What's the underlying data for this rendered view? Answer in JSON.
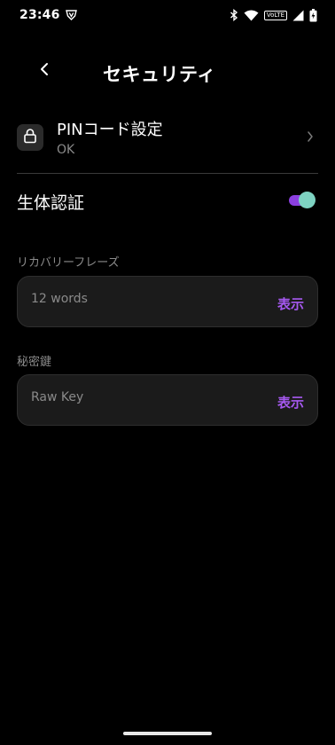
{
  "status_bar": {
    "time": "23:46",
    "icons": [
      "shield-v-icon",
      "bluetooth-icon",
      "wifi-icon",
      "volte-icon",
      "signal-icon",
      "battery-icon"
    ],
    "volte_label": "VoLTE"
  },
  "header": {
    "back_icon": "chevron-left-icon",
    "title": "セキュリティ"
  },
  "pin": {
    "icon": "lock-icon",
    "label": "PINコード設定",
    "status": "OK",
    "chevron_icon": "chevron-right-icon"
  },
  "biometric": {
    "label": "生体認証",
    "enabled": true
  },
  "recovery_phrase": {
    "section_label": "リカバリーフレーズ",
    "value": "12 words",
    "action_label": "表示"
  },
  "secret_key": {
    "section_label": "秘密鍵",
    "value": "Raw Key",
    "action_label": "表示"
  },
  "colors": {
    "background": "#000000",
    "accent": "#a659f0",
    "toggle_track": "#8b3fe0",
    "toggle_thumb": "#7ed3c2",
    "card_bg": "#1b1b1b",
    "muted_text": "#8a8a8a"
  }
}
